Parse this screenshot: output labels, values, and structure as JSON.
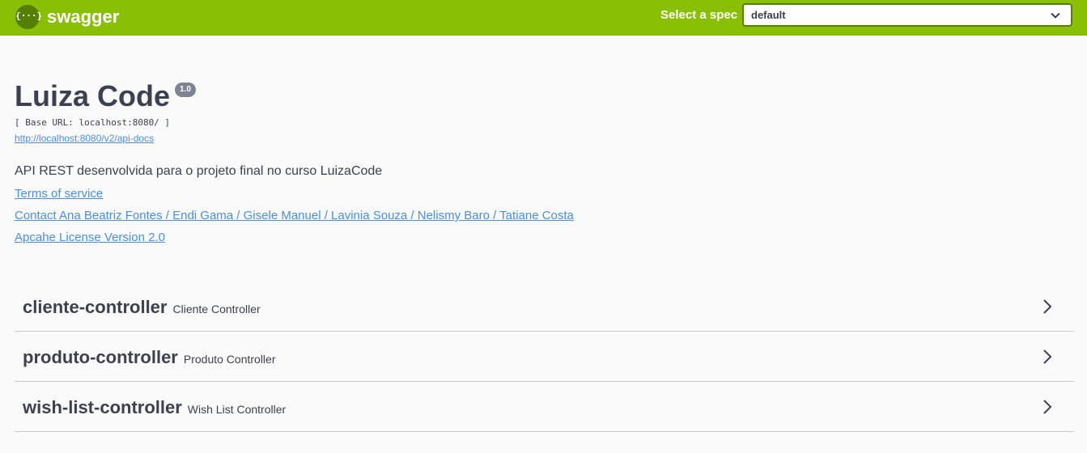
{
  "topbar": {
    "logo_glyph": "{···}",
    "brand": "swagger",
    "spec_label": "Select a spec",
    "spec_value": "default",
    "colors": {
      "background": "#89bf04",
      "logo": "#547f00"
    }
  },
  "info": {
    "title": "Luiza Code",
    "version": "1.0",
    "base_url": "[ Base URL: localhost:8080/ ]",
    "api_docs_link": "http://localhost:8080/v2/api-docs",
    "description": "API REST desenvolvida para o projeto final no curso LuizaCode",
    "terms_link": "Terms of service",
    "contact_link": "Contact Ana Beatriz Fontes / Endi Gama / Gisele Manuel / Lavinia Souza / Nelismy Baro / Tatiane Costa",
    "license_link": "Apcahe License Version 2.0"
  },
  "tags": [
    {
      "name": "cliente-controller",
      "description": "Cliente Controller"
    },
    {
      "name": "produto-controller",
      "description": "Produto Controller"
    },
    {
      "name": "wish-list-controller",
      "description": "Wish List Controller"
    }
  ],
  "icons": {
    "logo": "swagger-logo-icon",
    "select": "chevron-down-icon",
    "tag": "chevron-right-icon"
  },
  "colors": {
    "link": "#4990e2",
    "text": "#3b4151",
    "version_badge": "#7d8492"
  }
}
